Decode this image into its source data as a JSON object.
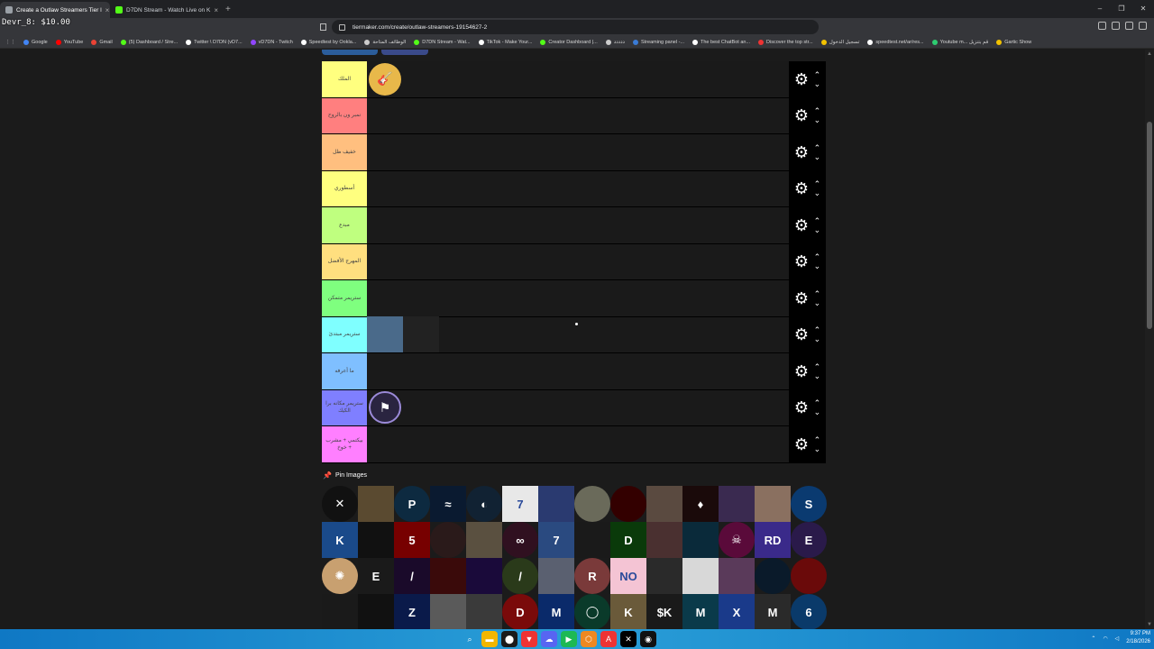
{
  "overlay_text": "Devr_8: $10.00",
  "tabs": [
    {
      "label": "Create a Outlaw Streamers Tier l",
      "active": true,
      "icon_color": "#9aa0a6"
    },
    {
      "label": "D7DN Stream - Watch Live on K",
      "active": false,
      "icon_color": "#53fc18"
    }
  ],
  "new_tab_label": "+",
  "window_controls": [
    "–",
    "❐",
    "✕"
  ],
  "address": {
    "url": "tiermaker.com/create/outlaw-streamers-19154627-2"
  },
  "bookmarks": [
    {
      "label": "Google",
      "color": "#4285f4"
    },
    {
      "label": "YouTube",
      "color": "#ff0000"
    },
    {
      "label": "Gmail",
      "color": "#ea4335"
    },
    {
      "label": "(5) Dashboard / Stre...",
      "color": "#53fc18"
    },
    {
      "label": "Twitter \\ D7DN (vD7...",
      "color": "#ffffff"
    },
    {
      "label": "vD7DN - Twitch",
      "color": "#9146ff"
    },
    {
      "label": "Speedtest by Ookla...",
      "color": "#ffffff"
    },
    {
      "label": "الوظائف المتاحة",
      "color": "#cccccc"
    },
    {
      "label": "D7DN Stream - Wat...",
      "color": "#53fc18"
    },
    {
      "label": "TikTok - Make Your...",
      "color": "#ffffff"
    },
    {
      "label": "Creator Dashboard |...",
      "color": "#53fc18"
    },
    {
      "label": "ددددد",
      "color": "#cccccc"
    },
    {
      "label": "Streaming panel -...",
      "color": "#3a7bd5"
    },
    {
      "label": "The best ChatBot an...",
      "color": "#ffffff"
    },
    {
      "label": "Discover the top str...",
      "color": "#e33"
    },
    {
      "label": "تسجيل الدخول",
      "color": "#f2c200"
    },
    {
      "label": "speedtest.net/ar/res...",
      "color": "#ffffff"
    },
    {
      "label": "Youtube m... قم بتنزيل",
      "color": "#2ecc71"
    },
    {
      "label": "Gartic Show",
      "color": "#f2c200"
    }
  ],
  "tiers": [
    {
      "label": "الملك",
      "color": "#ffff7f",
      "items": [
        {
          "icon": "guitar-avatar-icon",
          "bg": "#e8b84a",
          "glyph": "🎸",
          "circle": true
        }
      ]
    },
    {
      "label": "نمبر ون بالروح",
      "color": "#ff7f7f",
      "items": []
    },
    {
      "label": "خفيف ظل",
      "color": "#ffbf7f",
      "items": []
    },
    {
      "label": "أسطوري",
      "color": "#ffff7f",
      "items": []
    },
    {
      "label": "مبدع",
      "color": "#bfff7f",
      "items": []
    },
    {
      "label": "المهرج الأفضل",
      "color": "#ffdf7f",
      "items": []
    },
    {
      "label": "ستريمر متمكن",
      "color": "#7fff7f",
      "items": []
    },
    {
      "label": "ستريمر مبتدئ",
      "color": "#7fffff",
      "items": [
        {
          "icon": "anime-avatar-icon",
          "bg": "#4a6a8a",
          "glyph": "",
          "circle": false
        },
        {
          "icon": "dark-avatar-icon",
          "bg": "#222",
          "glyph": "",
          "circle": false
        }
      ]
    },
    {
      "label": "ما أعرفه",
      "color": "#7fbfff",
      "items": []
    },
    {
      "label": "ستريمر مكانه برا الكيك",
      "color": "#7f7fff",
      "items": [
        {
          "icon": "flag-logo-icon",
          "bg": "#2a2440",
          "glyph": "⚑",
          "circle": true
        }
      ]
    },
    {
      "label": "بيكتمي + مشرب + خوخ",
      "color": "#ff7fff",
      "items": []
    }
  ],
  "pin_label": "Pin Images",
  "pool": [
    {
      "g": "✕",
      "bg": "#111",
      "c": true
    },
    {
      "g": "",
      "bg": "#5a4a30",
      "c": false
    },
    {
      "g": "P",
      "bg": "#0d2a40",
      "c": true
    },
    {
      "g": "≈",
      "bg": "#0a1a30",
      "c": false
    },
    {
      "g": "◐",
      "bg": "#123",
      "c": true
    },
    {
      "g": "7",
      "bg": "#e8e8e8",
      "c": false
    },
    {
      "g": "",
      "bg": "#2a3a70",
      "c": false
    },
    {
      "g": "",
      "bg": "#6a6a5a",
      "c": true
    },
    {
      "g": "",
      "bg": "#300",
      "c": true
    },
    {
      "g": "",
      "bg": "#5a4a40",
      "c": false
    },
    {
      "g": "♦",
      "bg": "#1a0a0a",
      "c": false
    },
    {
      "g": "",
      "bg": "#3a2a50",
      "c": false
    },
    {
      "g": "",
      "bg": "#8a7060",
      "c": false
    },
    {
      "g": "S",
      "bg": "#0a3a70",
      "c": true
    },
    {
      "g": "K",
      "bg": "#1a4a8a",
      "c": false
    },
    {
      "g": "",
      "bg": "#111",
      "c": false
    },
    {
      "g": "5",
      "bg": "#700",
      "c": false
    },
    {
      "g": "",
      "bg": "#2a1a1a",
      "c": true
    },
    {
      "g": "",
      "bg": "#5a5040",
      "c": false
    },
    {
      "g": "∞",
      "bg": "#301020",
      "c": true
    },
    {
      "g": "7",
      "bg": "#2a4a80",
      "c": false
    },
    {
      "g": "",
      "bg": "#1a1a1a",
      "c": false
    },
    {
      "g": "D",
      "bg": "#0a3a0a",
      "c": false
    },
    {
      "g": "",
      "bg": "#4a3030",
      "c": false
    },
    {
      "g": "",
      "bg": "#0a2a3a",
      "c": false
    },
    {
      "g": "☠",
      "bg": "#5a0a3a",
      "c": true
    },
    {
      "g": "RD",
      "bg": "#3a2a8a",
      "c": false
    },
    {
      "g": "E",
      "bg": "#2a1a4a",
      "c": true
    },
    {
      "g": "✺",
      "bg": "#c8a070",
      "c": true
    },
    {
      "g": "E",
      "bg": "#1a1a1a",
      "c": false
    },
    {
      "g": "/",
      "bg": "#1a0a2a",
      "c": false
    },
    {
      "g": "",
      "bg": "#3a0a0a",
      "c": false
    },
    {
      "g": "",
      "bg": "#1a0a3a",
      "c": false
    },
    {
      "g": "/",
      "bg": "#2a3a1a",
      "c": true
    },
    {
      "g": "",
      "bg": "#5a6070",
      "c": false
    },
    {
      "g": "R",
      "bg": "#7a3a3a",
      "c": true
    },
    {
      "g": "NO",
      "bg": "#f4c4d4",
      "c": false
    },
    {
      "g": "",
      "bg": "#2a2a2a",
      "c": false
    },
    {
      "g": "",
      "bg": "#d8d8d8",
      "c": false
    },
    {
      "g": "",
      "bg": "#5a3a5a",
      "c": false
    },
    {
      "g": "",
      "bg": "#0a1a2a",
      "c": true
    },
    {
      "g": "",
      "bg": "#6a0a0a",
      "c": true
    },
    {
      "g": "",
      "bg": "#1a1a1a",
      "c": false
    },
    {
      "g": "",
      "bg": "#111",
      "c": false
    },
    {
      "g": "Z",
      "bg": "#0a1a4a",
      "c": false
    },
    {
      "g": "",
      "bg": "#5a5a5a",
      "c": false
    },
    {
      "g": "",
      "bg": "#3a3a3a",
      "c": false
    },
    {
      "g": "D",
      "bg": "#7a0a0a",
      "c": true
    },
    {
      "g": "M",
      "bg": "#0a2a6a",
      "c": false
    },
    {
      "g": "◯",
      "bg": "#0a3a2a",
      "c": true
    },
    {
      "g": "K",
      "bg": "#6a5a3a",
      "c": false
    },
    {
      "g": "$K",
      "bg": "#1a1a1a",
      "c": false
    },
    {
      "g": "M",
      "bg": "#0a3a4a",
      "c": false
    },
    {
      "g": "X",
      "bg": "#1a3a8a",
      "c": false
    },
    {
      "g": "M",
      "bg": "#2a2a2a",
      "c": false
    },
    {
      "g": "6",
      "bg": "#0a3a6a",
      "c": true
    }
  ],
  "taskbar_icons": [
    {
      "g": "⌕",
      "bg": "transparent"
    },
    {
      "g": "▬",
      "bg": "#f2b600"
    },
    {
      "g": "⬤",
      "bg": "#1a1a1a"
    },
    {
      "g": "▼",
      "bg": "#e33"
    },
    {
      "g": "☁",
      "bg": "#5865f2"
    },
    {
      "g": "▶",
      "bg": "#1db954"
    },
    {
      "g": "⬡",
      "bg": "#e82"
    },
    {
      "g": "A",
      "bg": "#e33"
    },
    {
      "g": "✕",
      "bg": "#000"
    },
    {
      "g": "◉",
      "bg": "#111"
    }
  ],
  "clock": {
    "time": "9:37 PM",
    "date": "2/18/2026"
  }
}
